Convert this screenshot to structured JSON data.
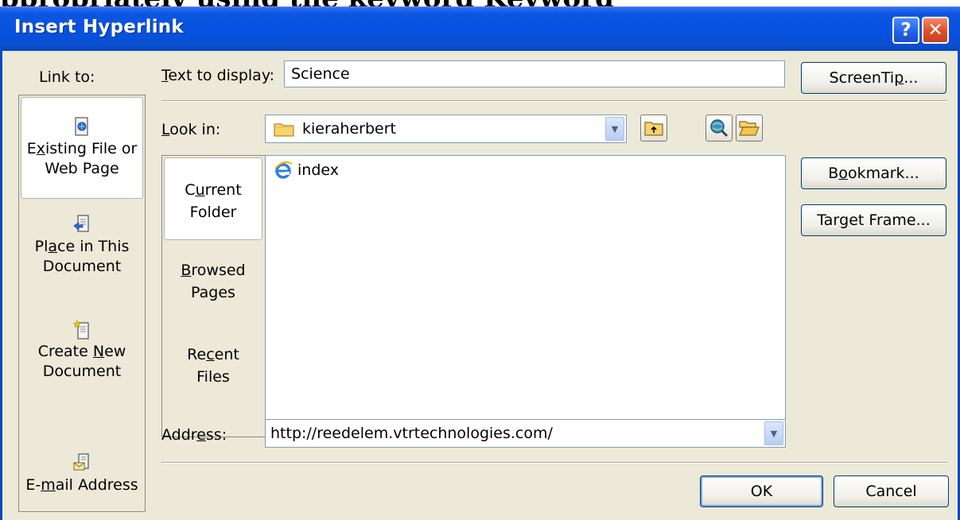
{
  "page_header_text": "ppropriately using the keyword Keyword",
  "window": {
    "title": "Insert Hyperlink",
    "help_glyph": "?",
    "close_glyph": "✕"
  },
  "link_to": {
    "label": "Link to:",
    "places": [
      {
        "line1": "E",
        "line1_u": "x",
        "line1_rest": "isting File or",
        "line2": "Web Page",
        "icon": "existing-file-icon",
        "active": true
      },
      {
        "line1": "Pl",
        "line1_u": "a",
        "line1_rest": "ce in This",
        "line2": "Document",
        "icon": "place-document-icon",
        "active": false
      },
      {
        "line1": "Create ",
        "line1_u": "N",
        "line1_rest": "ew",
        "line2": "Document",
        "icon": "new-document-icon",
        "active": false
      },
      {
        "line1": "E-",
        "line1_u": "m",
        "line1_rest": "ail Address",
        "line2": "",
        "icon": "email-address-icon",
        "active": false
      }
    ]
  },
  "text_to_display": {
    "label_u": "T",
    "label_rest": "ext to display:",
    "value": "Science"
  },
  "screentip_button": {
    "pre": "ScreenTi",
    "u": "p",
    "post": "..."
  },
  "look_in": {
    "label_u": "L",
    "label_rest": "ook in:",
    "value": "kieraherbert"
  },
  "tabs": [
    {
      "l1_pre": "C",
      "l1_u": "u",
      "l1_post": "rrent",
      "l2": "Folder",
      "active": true
    },
    {
      "l1_pre": "",
      "l1_u": "B",
      "l1_post": "rowsed",
      "l2": "Pages",
      "active": false
    },
    {
      "l1_pre": "Re",
      "l1_u": "c",
      "l1_post": "ent",
      "l2": "Files",
      "active": false
    }
  ],
  "files": [
    {
      "name": "index",
      "icon": "ie-page-icon"
    }
  ],
  "side_buttons": {
    "bookmark": {
      "pre": "B",
      "u": "o",
      "post": "okmark..."
    },
    "target_frame": {
      "pre": "Tar",
      "u": "g",
      "post": "et Frame..."
    }
  },
  "address": {
    "label_pre": "Addr",
    "label_u": "e",
    "label_post": "ss:",
    "value": "http://reedelem.vtrtechnologies.com/"
  },
  "ok_label": "OK",
  "cancel_label": "Cancel",
  "colors": {
    "titlebar": "#0553e0",
    "dialog_bg": "#ece9d8",
    "close_btn": "#e0522d"
  }
}
